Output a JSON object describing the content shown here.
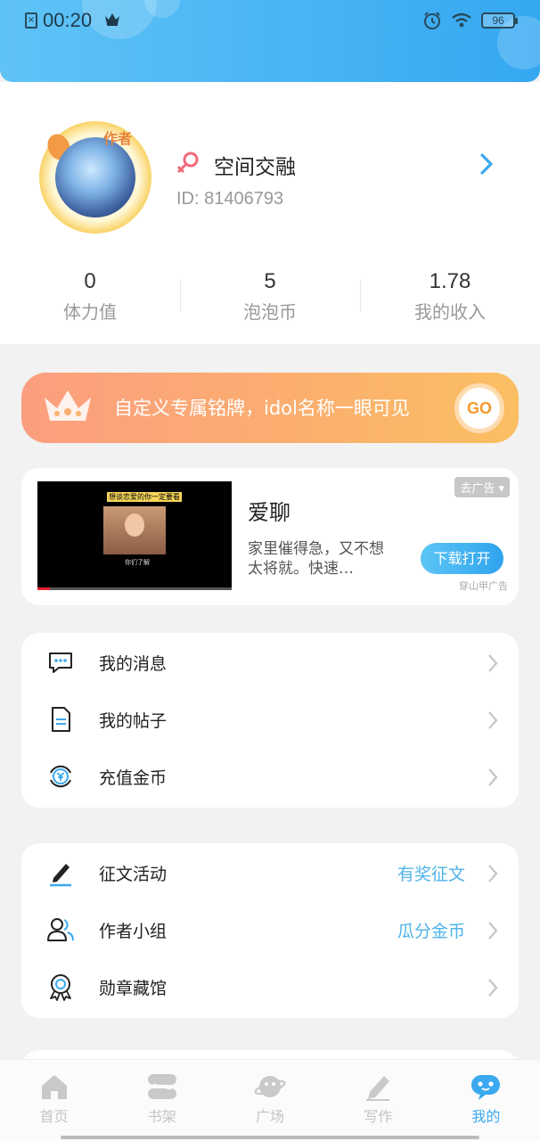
{
  "status_bar": {
    "time": "00:20",
    "battery": "96",
    "sim_label": "×"
  },
  "profile": {
    "avatar_tag": "作者",
    "nickname": "空间交融",
    "id_label": "ID:",
    "id_value": "81406793"
  },
  "stats": [
    {
      "value": "0",
      "label": "体力值"
    },
    {
      "value": "5",
      "label": "泡泡币"
    },
    {
      "value": "1.78",
      "label": "我的收入"
    }
  ],
  "banner": {
    "text": "自定义专属铭牌，idol名称一眼可见",
    "go": "GO"
  },
  "ad": {
    "title": "爱聊",
    "description": "家里催得急，又不想太将就。快速…",
    "close_label": "去广告",
    "download_label": "下载打开",
    "source": "穿山甲广告",
    "video_caption": "想谈恋爱的你一定要看",
    "video_sub": "你们了解"
  },
  "menu_group_1": [
    {
      "label": "我的消息",
      "icon": "message-icon"
    },
    {
      "label": "我的帖子",
      "icon": "document-icon"
    },
    {
      "label": "充值金币",
      "icon": "yuan-coin-icon"
    }
  ],
  "menu_group_2": [
    {
      "label": "征文活动",
      "extra": "有奖征文",
      "icon": "pen-icon"
    },
    {
      "label": "作者小组",
      "extra": "瓜分金币",
      "icon": "group-icon"
    },
    {
      "label": "勋章藏馆",
      "extra": "",
      "icon": "medal-icon"
    }
  ],
  "tabs": [
    {
      "label": "首页",
      "icon": "home-icon"
    },
    {
      "label": "书架",
      "icon": "bookshelf-icon"
    },
    {
      "label": "广场",
      "icon": "planet-icon"
    },
    {
      "label": "写作",
      "icon": "write-icon"
    },
    {
      "label": "我的",
      "icon": "profile-bubble-icon",
      "active": true
    }
  ],
  "colors": {
    "accent": "#3aa9ef",
    "header_start": "#5fc3f6",
    "header_end": "#35a8f2",
    "banner_start": "#fb9e7f",
    "banner_end": "#fbbf62"
  }
}
